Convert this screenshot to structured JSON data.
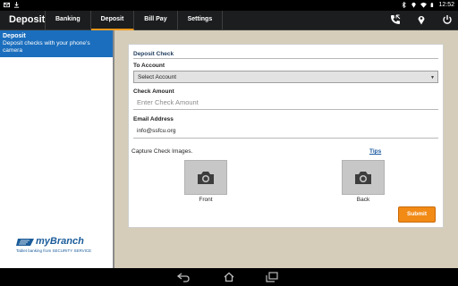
{
  "statusbar": {
    "time": "12:52",
    "icons": [
      "email-icon",
      "download-icon",
      "bluetooth-icon",
      "location-icon",
      "wifi-icon",
      "battery-icon"
    ]
  },
  "app": {
    "title": "Deposit",
    "tabs": [
      {
        "label": "Banking",
        "active": false
      },
      {
        "label": "Deposit",
        "active": true
      },
      {
        "label": "Bill Pay",
        "active": false
      },
      {
        "label": "Settings",
        "active": false
      }
    ],
    "action_icons": [
      "phone-icon",
      "map-pin-icon",
      "power-icon"
    ]
  },
  "sidebar": {
    "items": [
      {
        "title": "Deposit",
        "description": "Deposit checks with your phone's camera",
        "selected": true
      }
    ],
    "brand": {
      "name": "myBranch",
      "tagline": "Tablet banking from SECURITY SERVICE"
    }
  },
  "form": {
    "section_title": "Deposit Check",
    "to_account_label": "To Account",
    "to_account_value": "Select Account",
    "check_amount_label": "Check Amount",
    "check_amount_placeholder": "Enter Check Amount",
    "email_label": "Email Address",
    "email_value": "info@ssfcu.org",
    "capture_label": "Capture Check Images.",
    "tips_label": "Tips",
    "front_label": "Front",
    "back_label": "Back",
    "submit_label": "Submit"
  },
  "colors": {
    "accent": "#f28a16",
    "selected": "#1b6ebd",
    "background": "#d5cdb9"
  },
  "navbar": {
    "icons": [
      "back-icon",
      "home-icon",
      "recents-icon"
    ]
  }
}
